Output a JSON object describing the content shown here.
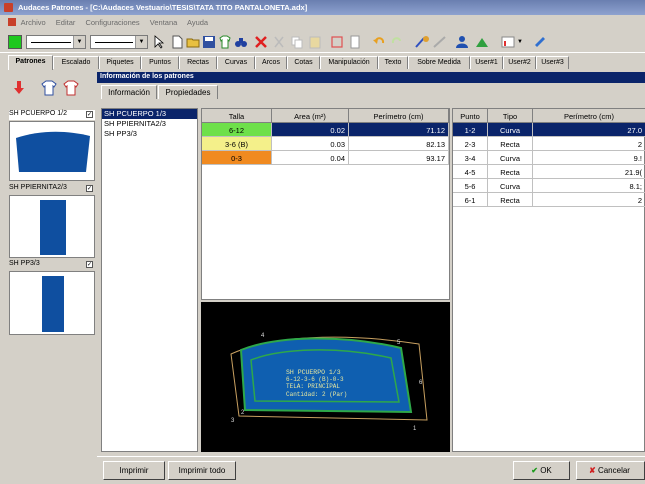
{
  "window": {
    "title": "Audaces Patrones - [C:\\Audaces Vestuario\\TESIS\\TATA TITO PANTALONETA.adx]"
  },
  "menu": [
    "Archivo",
    "Editar",
    "Configuraciones",
    "Ventana",
    "Ayuda"
  ],
  "tabs": [
    "Patrones",
    "Escalado",
    "Piquetes",
    "Puntos",
    "Rectas",
    "Curvas",
    "Arcos",
    "Cotas",
    "Manipulación",
    "Texto",
    "Sobre Medida",
    "User#1",
    "User#2",
    "User#3"
  ],
  "thumbnails": [
    {
      "label": "SH PCUERPO 1/2",
      "checked": "✓"
    },
    {
      "label": "SH PPIERNITA2/3",
      "checked": "✓"
    },
    {
      "label": "SH PP3/3",
      "checked": "✓"
    }
  ],
  "info": {
    "header": "Información de los patrones",
    "subtabs": [
      "Información",
      "Propiedades"
    ]
  },
  "pattern_list": [
    "SH PCUERPO 1/3",
    "SH PPIERNITA2/3",
    "SH PP3/3"
  ],
  "size_table": {
    "headers": [
      "Talla",
      "Area (m²)",
      "Perímetro (cm)"
    ],
    "rows": [
      {
        "talla": "6-12",
        "area": "0.02",
        "perimetro": "71.12",
        "color": "#6ee04a"
      },
      {
        "talla": "3-6 (B)",
        "area": "0.03",
        "perimetro": "82.13",
        "color": "#f4f08a"
      },
      {
        "talla": "0-3",
        "area": "0.04",
        "perimetro": "93.17",
        "color": "#f08a20"
      }
    ]
  },
  "point_table": {
    "headers": [
      "Punto",
      "Tipo",
      "Perímetro (cm)"
    ],
    "rows": [
      {
        "punto": "1-2",
        "tipo": "Curva",
        "perimetro": "27.0"
      },
      {
        "punto": "2-3",
        "tipo": "Recta",
        "perimetro": "2"
      },
      {
        "punto": "3-4",
        "tipo": "Curva",
        "perimetro": "9.!"
      },
      {
        "punto": "4-5",
        "tipo": "Recta",
        "perimetro": "21.9("
      },
      {
        "punto": "5-6",
        "tipo": "Curva",
        "perimetro": "8.1;"
      },
      {
        "punto": "6-1",
        "tipo": "Recta",
        "perimetro": "2"
      }
    ]
  },
  "preview": {
    "lines": [
      "SH PCUERPO 1/3",
      "6-12-3-6 (B)-0-3",
      "TELA: PRINCIPAL",
      "Cantidad: 2 (Par)"
    ],
    "points": [
      "1",
      "2",
      "3",
      "4",
      "5",
      "6"
    ]
  },
  "buttons": {
    "print": "Imprimir",
    "print_all": "Imprimir todo",
    "ok": "OK",
    "cancel": "Cancelar"
  },
  "colors": {
    "accent": "#0a246a",
    "pattern_fill": "#0f4fa0",
    "preview_outline": "#2ea84a"
  }
}
